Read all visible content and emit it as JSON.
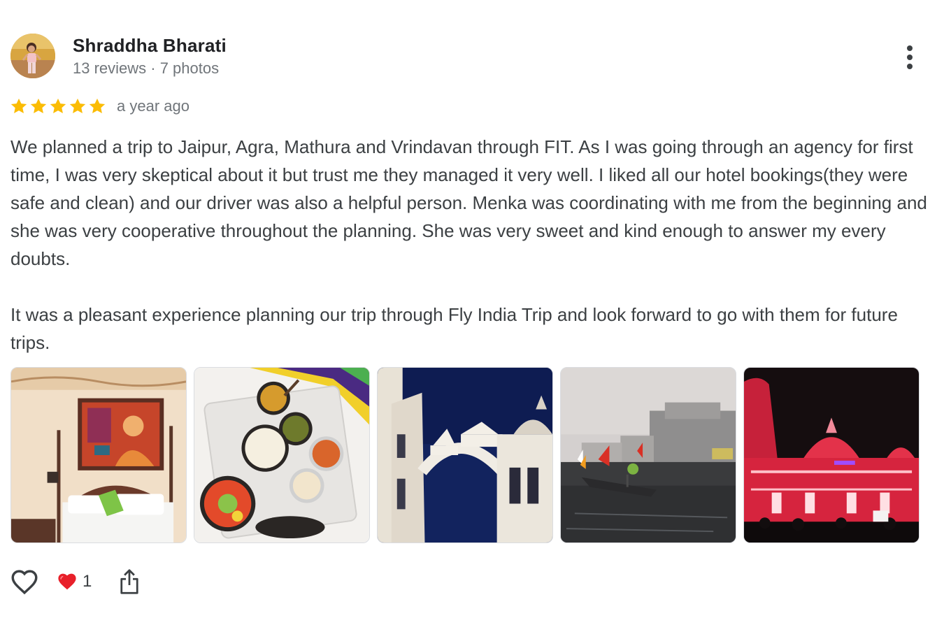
{
  "reviewer": {
    "name": "Shraddha Bharati",
    "meta": "13 reviews · 7 photos",
    "avatar_icon": "profile-photo"
  },
  "rating": {
    "stars": 5,
    "star_color": "#fbbc04",
    "date": "a year ago"
  },
  "review": {
    "paragraphs": [
      "We planned a trip to Jaipur, Agra, Mathura and Vrindavan through FIT. As I was going through an agency for first time, I was very skeptical about it but trust me they managed it very well. I liked all our hotel bookings(they were safe and clean) and our driver was also a helpful person. Menka was coordinating with me from the beginning and she was very cooperative throughout the planning. She was very sweet and kind enough to answer my every doubts.",
      "It was a pleasant experience planning our trip through Fly India Trip and look forward to go with them for future trips."
    ]
  },
  "photos": [
    {
      "subject": "hotel-room-with-painting"
    },
    {
      "subject": "food-thali-tray"
    },
    {
      "subject": "white-marble-temple-night"
    },
    {
      "subject": "river-ghats-boat"
    },
    {
      "subject": "red-lit-temple-night"
    }
  ],
  "actions": {
    "like_icon": "heart-outline-icon",
    "reaction_icon": "red-heart-icon",
    "reaction_count": "1",
    "share_icon": "share-icon",
    "menu_icon": "more-vert-icon"
  },
  "colors": {
    "name": "#202124",
    "text": "#3c4043",
    "secondary": "#70757a",
    "heart_red": "#e8202a"
  }
}
